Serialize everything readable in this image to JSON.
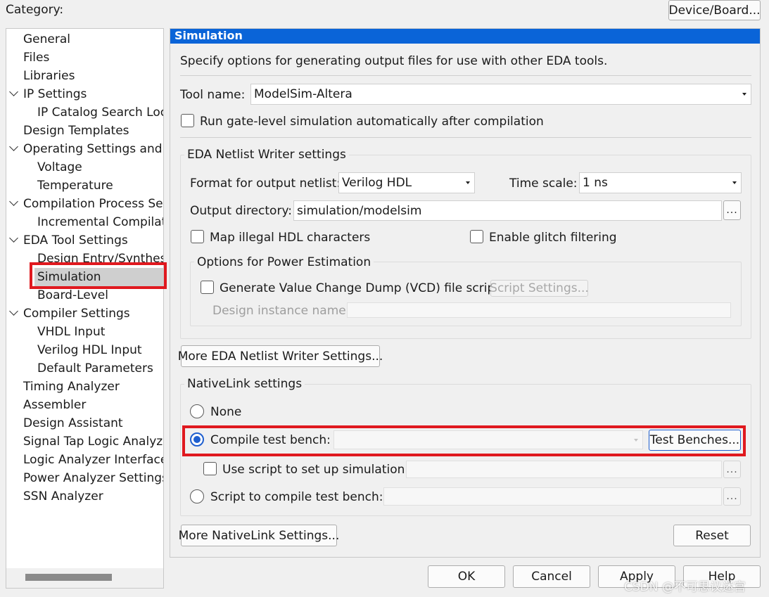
{
  "header": {
    "category_label": "Category:",
    "device_board_button": "Device/Board..."
  },
  "sidebar": {
    "items": [
      {
        "label": "General",
        "level": 0,
        "expandable": false
      },
      {
        "label": "Files",
        "level": 0,
        "expandable": false
      },
      {
        "label": "Libraries",
        "level": 0,
        "expandable": false
      },
      {
        "label": "IP Settings",
        "level": 0,
        "expandable": true
      },
      {
        "label": "IP Catalog Search Loca",
        "level": 1,
        "expandable": false
      },
      {
        "label": "Design Templates",
        "level": 0,
        "expandable": false
      },
      {
        "label": "Operating Settings and C",
        "level": 0,
        "expandable": true
      },
      {
        "label": "Voltage",
        "level": 1,
        "expandable": false
      },
      {
        "label": "Temperature",
        "level": 1,
        "expandable": false
      },
      {
        "label": "Compilation Process Set",
        "level": 0,
        "expandable": true
      },
      {
        "label": "Incremental Compilati",
        "level": 1,
        "expandable": false
      },
      {
        "label": "EDA Tool Settings",
        "level": 0,
        "expandable": true
      },
      {
        "label": "Design Entry/Synthesi",
        "level": 1,
        "expandable": false
      },
      {
        "label": "Simulation",
        "level": 1,
        "expandable": false,
        "selected": true
      },
      {
        "label": "Board-Level",
        "level": 1,
        "expandable": false
      },
      {
        "label": "Compiler Settings",
        "level": 0,
        "expandable": true
      },
      {
        "label": "VHDL Input",
        "level": 1,
        "expandable": false
      },
      {
        "label": "Verilog HDL Input",
        "level": 1,
        "expandable": false
      },
      {
        "label": "Default Parameters",
        "level": 1,
        "expandable": false
      },
      {
        "label": "Timing Analyzer",
        "level": 0,
        "expandable": false
      },
      {
        "label": "Assembler",
        "level": 0,
        "expandable": false
      },
      {
        "label": "Design Assistant",
        "level": 0,
        "expandable": false
      },
      {
        "label": "Signal Tap Logic Analyze",
        "level": 0,
        "expandable": false
      },
      {
        "label": "Logic Analyzer Interface",
        "level": 0,
        "expandable": false
      },
      {
        "label": "Power Analyzer Settings",
        "level": 0,
        "expandable": false
      },
      {
        "label": "SSN Analyzer",
        "level": 0,
        "expandable": false
      }
    ]
  },
  "panel": {
    "title": "Simulation",
    "description": "Specify options for generating output files for use with other EDA tools.",
    "tool_name_label": "Tool name:",
    "tool_name_value": "ModelSim-Altera",
    "run_gate_level_label": "Run gate-level simulation automatically after compilation",
    "run_gate_level_checked": false,
    "eda_netlist": {
      "group_title": "EDA Netlist Writer settings",
      "format_label": "Format for output netlist:",
      "format_value": "Verilog HDL",
      "time_scale_label": "Time scale:",
      "time_scale_value": "1 ns",
      "output_dir_label": "Output directory:",
      "output_dir_value": "simulation/modelsim",
      "browse": "...",
      "map_illegal_label": "Map illegal HDL characters",
      "map_illegal_checked": false,
      "glitch_label": "Enable glitch filtering",
      "glitch_checked": false,
      "power": {
        "group_title": "Options for Power Estimation",
        "vcd_label": "Generate Value Change Dump (VCD) file script",
        "vcd_checked": false,
        "script_settings_button": "Script Settings...",
        "design_instance_label": "Design instance name:",
        "design_instance_value": ""
      }
    },
    "more_eda_button": "More EDA Netlist Writer Settings...",
    "nativelink": {
      "group_title": "NativeLink settings",
      "none_label": "None",
      "compile_tb_label": "Compile test bench:",
      "compile_tb_value": "",
      "test_benches_button": "Test Benches...",
      "use_script_label": "Use script to set up simulation:",
      "use_script_value": "",
      "script_compile_label": "Script to compile test bench:",
      "script_compile_value": "",
      "browse": "...",
      "selected_option": "compile_test_bench"
    },
    "more_nativelink_button": "More NativeLink Settings...",
    "reset_button": "Reset"
  },
  "footer": {
    "ok": "OK",
    "cancel": "Cancel",
    "apply": "Apply",
    "help": "Help"
  },
  "watermark": "CSDN @不可思议迷宫",
  "colors": {
    "panel_title_bg": "#0a64d8",
    "highlight_red": "#e0191f",
    "selected_bg": "#cfcfcf",
    "radio_blue": "#1f5fcf"
  }
}
